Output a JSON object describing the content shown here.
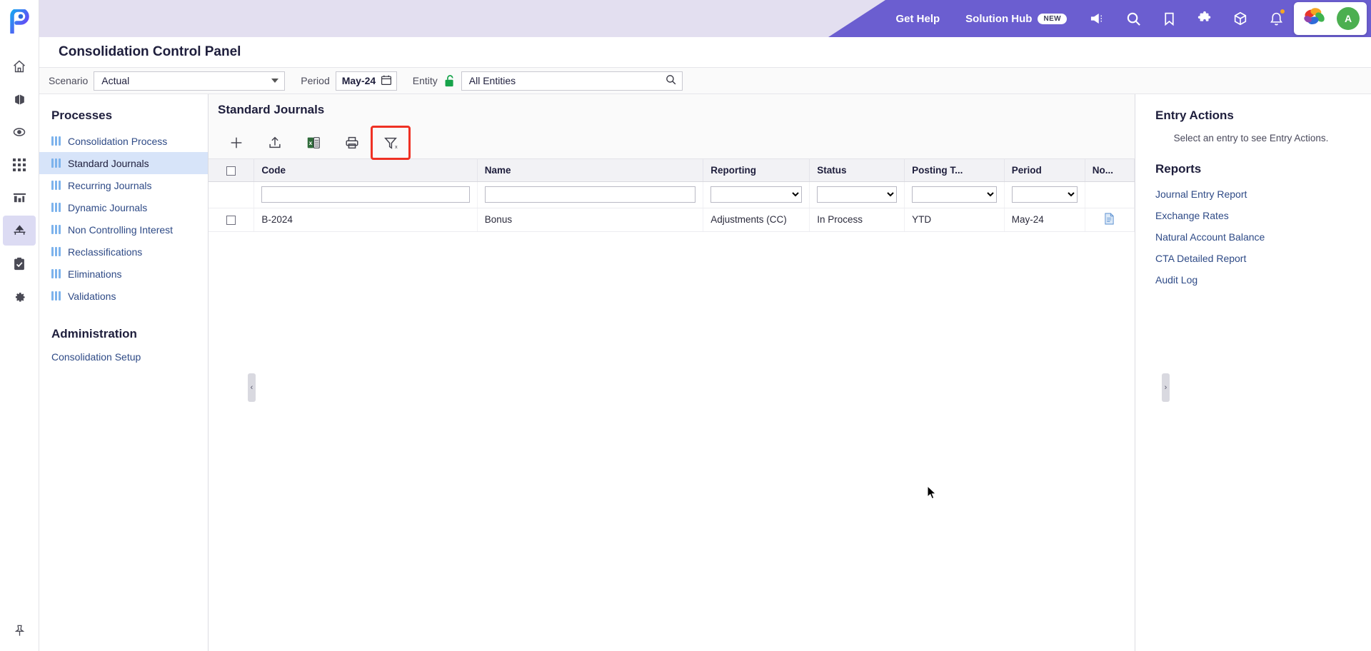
{
  "header": {
    "get_help": "Get Help",
    "solution_hub": "Solution Hub",
    "new_badge": "NEW",
    "avatar_initial": "A",
    "accent_purple": "#6b5ed0",
    "accent_lavender": "#e3dff0",
    "icons": [
      "megaphone-icon",
      "search-icon",
      "bookmark-icon",
      "puzzle-icon",
      "cube-icon",
      "bell-icon"
    ]
  },
  "page": {
    "title": "Consolidation Control Panel"
  },
  "filters": {
    "scenario_label": "Scenario",
    "scenario_value": "Actual",
    "period_label": "Period",
    "period_value": "May-24",
    "entity_label": "Entity",
    "entity_value": "All Entities"
  },
  "rail": {
    "items": [
      "home-icon",
      "cube-icon",
      "eye-icon",
      "grid-icon",
      "bar-chart-icon",
      "hierarchy-icon",
      "clipboard-check-icon",
      "gear-icon"
    ],
    "active_index": 5,
    "pin_icon": "pin-icon"
  },
  "sidebar": {
    "processes_heading": "Processes",
    "items": [
      {
        "label": "Consolidation Process",
        "active": false
      },
      {
        "label": "Standard Journals",
        "active": true
      },
      {
        "label": "Recurring Journals",
        "active": false
      },
      {
        "label": "Dynamic Journals",
        "active": false
      },
      {
        "label": "Non Controlling Interest",
        "active": false
      },
      {
        "label": "Reclassifications",
        "active": false
      },
      {
        "label": "Eliminations",
        "active": false
      },
      {
        "label": "Validations",
        "active": false
      }
    ],
    "administration_heading": "Administration",
    "administration_link": "Consolidation Setup"
  },
  "main": {
    "panel_title": "Standard Journals",
    "toolbar": [
      {
        "name": "add-icon",
        "label": "Add",
        "highlighted": false
      },
      {
        "name": "upload-icon",
        "label": "Import",
        "highlighted": false
      },
      {
        "name": "excel-export-icon",
        "label": "Export to Excel",
        "highlighted": false
      },
      {
        "name": "print-icon",
        "label": "Print",
        "highlighted": false
      },
      {
        "name": "clear-filter-icon",
        "label": "Clear Filter",
        "highlighted": true
      }
    ],
    "highlight_color": "#ef3124",
    "columns": [
      "Code",
      "Name",
      "Reporting",
      "Status",
      "Posting T...",
      "Period",
      "No..."
    ],
    "filter_row": {
      "code": "",
      "name": "",
      "reporting": "",
      "status": "",
      "posting_type": "",
      "period": ""
    },
    "rows": [
      {
        "code": "B-2024",
        "name": "Bonus",
        "reporting": "Adjustments (CC)",
        "status": "In Process",
        "posting_type": "YTD",
        "period": "May-24",
        "note_icon": "document-icon"
      }
    ]
  },
  "right": {
    "entry_actions_heading": "Entry Actions",
    "entry_actions_hint": "Select an entry to see Entry Actions.",
    "reports_heading": "Reports",
    "reports": [
      "Journal Entry Report",
      "Exchange Rates",
      "Natural Account Balance",
      "CTA Detailed Report",
      "Audit Log"
    ]
  }
}
